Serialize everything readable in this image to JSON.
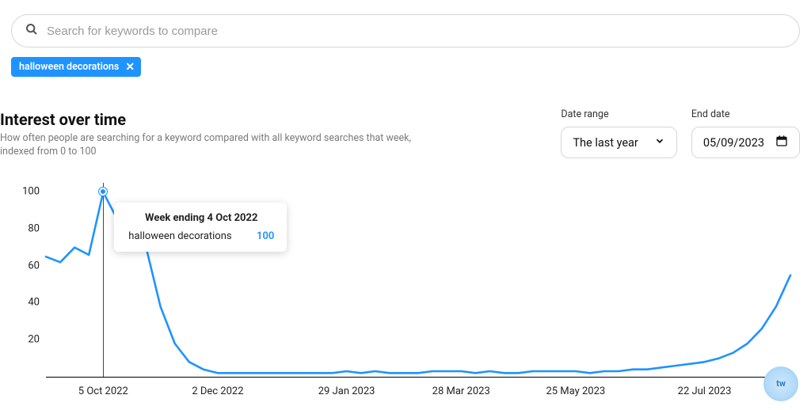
{
  "search": {
    "placeholder": "Search for keywords to compare"
  },
  "chip": {
    "label": "halloween decorations"
  },
  "heading": {
    "title": "Interest over time",
    "subtitle": "How often people are searching for a keyword compared with all keyword searches that week, indexed from 0 to 100"
  },
  "controls": {
    "range_label": "Date range",
    "range_value": "The last year",
    "enddate_label": "End date",
    "enddate_value": "05/09/2023"
  },
  "tooltip": {
    "title": "Week ending 4 Oct 2022",
    "series": "halloween decorations",
    "value": "100"
  },
  "badge": {
    "text": "tw"
  },
  "chart_data": {
    "type": "line",
    "title": "Interest over time",
    "xlabel": "",
    "ylabel": "",
    "ylim": [
      0,
      105
    ],
    "series": [
      {
        "name": "halloween decorations",
        "color": "#1f93ff",
        "x": [
          "6 Sep 2022",
          "13 Sep 2022",
          "20 Sep 2022",
          "27 Sep 2022",
          "4 Oct 2022",
          "11 Oct 2022",
          "18 Oct 2022",
          "25 Oct 2022",
          "1 Nov 2022",
          "8 Nov 2022",
          "15 Nov 2022",
          "22 Nov 2022",
          "29 Nov 2022",
          "6 Dec 2022",
          "13 Dec 2022",
          "20 Dec 2022",
          "27 Dec 2022",
          "3 Jan 2023",
          "10 Jan 2023",
          "17 Jan 2023",
          "24 Jan 2023",
          "31 Jan 2023",
          "7 Feb 2023",
          "14 Feb 2023",
          "21 Feb 2023",
          "28 Feb 2023",
          "7 Mar 2023",
          "14 Mar 2023",
          "21 Mar 2023",
          "28 Mar 2023",
          "4 Apr 2023",
          "11 Apr 2023",
          "18 Apr 2023",
          "25 Apr 2023",
          "2 May 2023",
          "9 May 2023",
          "16 May 2023",
          "23 May 2023",
          "30 May 2023",
          "6 Jun 2023",
          "13 Jun 2023",
          "20 Jun 2023",
          "27 Jun 2023",
          "4 Jul 2023",
          "11 Jul 2023",
          "18 Jul 2023",
          "25 Jul 2023",
          "1 Aug 2023",
          "8 Aug 2023",
          "15 Aug 2023",
          "22 Aug 2023",
          "29 Aug 2023",
          "5 Sep 2023"
        ],
        "values": [
          65,
          62,
          70,
          66,
          100,
          85,
          78,
          70,
          38,
          18,
          8,
          4,
          2,
          2,
          2,
          2,
          2,
          2,
          2,
          2,
          2,
          3,
          2,
          3,
          2,
          2,
          2,
          3,
          3,
          3,
          2,
          3,
          2,
          2,
          3,
          3,
          3,
          3,
          2,
          3,
          3,
          4,
          4,
          5,
          6,
          7,
          8,
          10,
          13,
          18,
          26,
          38,
          55
        ]
      }
    ],
    "x_tick_labels": [
      "5 Oct 2022",
      "2 Dec 2022",
      "29 Jan 2023",
      "28 Mar 2023",
      "25 May 2023",
      "22 Jul 2023"
    ],
    "x_tick_idx": [
      4,
      12,
      21,
      29,
      37,
      46
    ],
    "y_ticks": [
      20,
      40,
      60,
      80,
      100
    ],
    "highlight_idx": 4
  }
}
